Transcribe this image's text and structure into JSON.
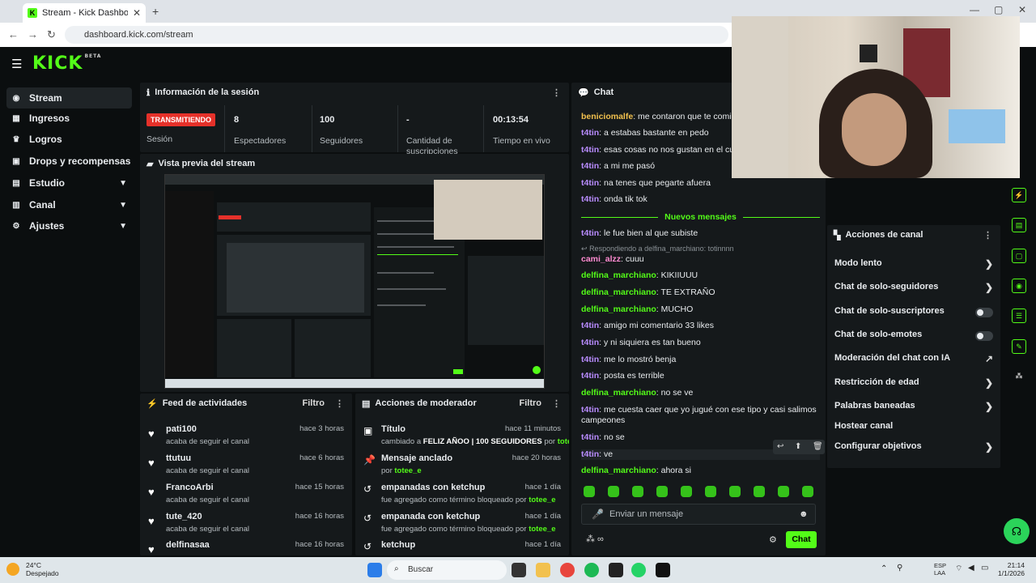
{
  "browser": {
    "tab_title": "Stream - Kick Dashboard",
    "url": "dashboard.kick.com/stream"
  },
  "app": {
    "logo": "KICK",
    "logo_badge": "BETA"
  },
  "sidebar": {
    "items": [
      {
        "label": "Stream"
      },
      {
        "label": "Ingresos"
      },
      {
        "label": "Logros"
      },
      {
        "label": "Drops y recompensas"
      },
      {
        "label": "Estudio"
      },
      {
        "label": "Canal"
      },
      {
        "label": "Ajustes"
      }
    ]
  },
  "session": {
    "title": "Información de la sesión",
    "live_badge": "TRANSMITIENDO",
    "session_label": "Sesión",
    "viewers_value": "8",
    "viewers_label": "Espectadores",
    "followers_value": "100",
    "followers_label": "Seguidores",
    "subs_value": "-",
    "subs_label": "Cantidad de suscripciones",
    "uptime_value": "00:13:54",
    "uptime_label": "Tiempo en vivo"
  },
  "preview": {
    "title": "Vista previa del stream"
  },
  "activity_feed": {
    "title": "Feed de actividades",
    "filter": "Filtro",
    "items": [
      {
        "name": "pati100",
        "sub": "acaba de seguir el canal",
        "time": "hace 3 horas"
      },
      {
        "name": "ttutuu",
        "sub": "acaba de seguir el canal",
        "time": "hace 6 horas"
      },
      {
        "name": "FrancoArbi",
        "sub": "acaba de seguir el canal",
        "time": "hace 15 horas"
      },
      {
        "name": "tute_420",
        "sub": "acaba de seguir el canal",
        "time": "hace 16 horas"
      },
      {
        "name": "delfinasaa",
        "sub": "",
        "time": "hace 16 horas"
      }
    ]
  },
  "mod_actions": {
    "title": "Acciones de moderador",
    "filter": "Filtro",
    "items": [
      {
        "name": "Título",
        "time": "hace 11 minutos",
        "pre": "cambiado a ",
        "bold": "FELIZ AÑOO | 100 SEGUIDORES",
        "mid": " por ",
        "user": "totee_e"
      },
      {
        "name": "Mensaje anclado",
        "time": "hace 20 horas",
        "pre": "por ",
        "bold": "",
        "mid": "",
        "user": "totee_e"
      },
      {
        "name": "empanadas con ketchup",
        "time": "hace 1 día",
        "pre": "fue agregado como término bloqueado por ",
        "bold": "",
        "mid": "",
        "user": "totee_e"
      },
      {
        "name": "empanada con ketchup",
        "time": "hace 1 día",
        "pre": "fue agregado como término bloqueado por ",
        "bold": "",
        "mid": "",
        "user": "totee_e"
      },
      {
        "name": "ketchup",
        "time": "hace 1 día",
        "pre": "",
        "bold": "",
        "mid": "",
        "user": ""
      }
    ]
  },
  "chat": {
    "title": "Chat",
    "new_messages": "Nuevos mensajes",
    "reply_to": "Respondiendo a delfina_marchiano: totinnnn",
    "messages_before": [
      {
        "user": "beniciomalfe",
        "text": "me contaron que te comiste a c"
      },
      {
        "user": "t4tin",
        "text": "a estabas bastante en pedo"
      },
      {
        "user": "t4tin",
        "text": "esas cosas no nos gustan en el cuerpo"
      },
      {
        "user": "t4tin",
        "text": "a mi me pasó"
      },
      {
        "user": "t4tin",
        "text": "na tenes que pegarte afuera"
      },
      {
        "user": "t4tin",
        "text": "onda tik tok"
      }
    ],
    "messages_after": [
      {
        "user": "t4tin",
        "text": "le fue bien al que subiste"
      },
      {
        "user": "cami_alzz",
        "text": "cuuu"
      },
      {
        "user": "delfina_marchiano",
        "text": "KIKIIUUU"
      },
      {
        "user": "delfina_marchiano",
        "text": "TE EXTRAÑO"
      },
      {
        "user": "delfina_marchiano",
        "text": "MUCHO"
      },
      {
        "user": "t4tin",
        "text": "amigo mi comentario 33 likes"
      },
      {
        "user": "t4tin",
        "text": "y ni siquiera es tan bueno"
      },
      {
        "user": "t4tin",
        "text": "me lo mostró benja"
      },
      {
        "user": "t4tin",
        "text": "posta es terrible"
      },
      {
        "user": "delfina_marchiano",
        "text": "no se ve"
      },
      {
        "user": "t4tin",
        "text": "me cuesta caer que yo jugué con ese tipo y casi salimos campeones"
      },
      {
        "user": "t4tin",
        "text": "no se"
      },
      {
        "user": "t4tin",
        "text": "ve"
      },
      {
        "user": "delfina_marchiano",
        "text": "ahora si"
      }
    ],
    "input_placeholder": "Enviar un mensaje",
    "send_label": "Chat"
  },
  "channel_actions": {
    "title": "Acciones de canal",
    "items": [
      {
        "label": "Modo lento"
      },
      {
        "label": "Chat de solo-seguidores"
      },
      {
        "label": "Chat de solo-suscriptores"
      },
      {
        "label": "Chat de solo-emotes"
      },
      {
        "label": "Moderación del chat con IA"
      },
      {
        "label": "Restricción de edad"
      },
      {
        "label": "Palabras baneadas"
      },
      {
        "label": "Hostear canal"
      },
      {
        "label": "Configurar objetivos"
      }
    ]
  },
  "taskbar": {
    "temp": "24°C",
    "weather": "Despejado",
    "search": "Buscar",
    "lang1": "ESP",
    "lang2": "LAA",
    "time": "21:14",
    "date": "1/1/2026"
  }
}
